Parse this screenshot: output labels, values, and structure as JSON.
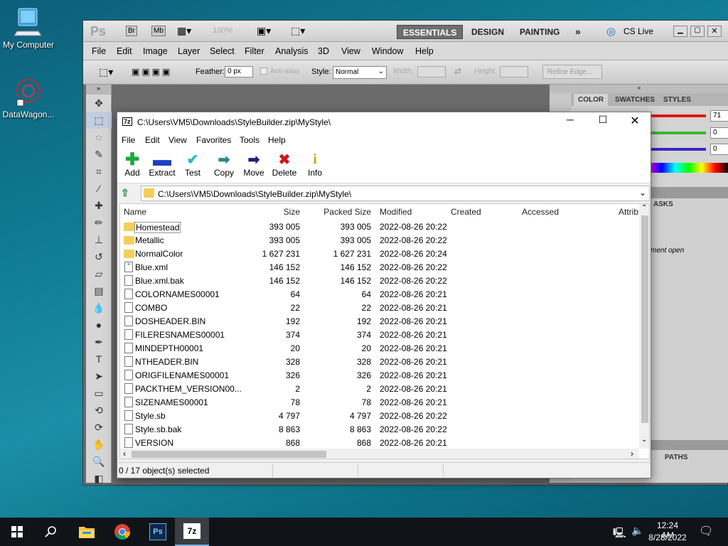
{
  "desktop": {
    "icons": [
      {
        "label": "My Computer",
        "icon": "computer-icon"
      },
      {
        "label": "DataWagon...",
        "icon": "datawagon-icon"
      }
    ]
  },
  "photoshop": {
    "logo": "Ps",
    "app_buttons": [
      "Br",
      "Mb"
    ],
    "zoom": "100%",
    "workspaces": [
      "ESSENTIALS",
      "DESIGN",
      "PAINTING"
    ],
    "more": "»",
    "cslive": "CS Live",
    "menu": [
      "File",
      "Edit",
      "Image",
      "Layer",
      "Select",
      "Filter",
      "Analysis",
      "3D",
      "View",
      "Window",
      "Help"
    ],
    "options": {
      "feather_label": "Feather:",
      "feather_value": "0 px",
      "antialias": "Anti-alias",
      "style_label": "Style:",
      "style_value": "Normal",
      "width_label": "Width:",
      "height_label": "Height:",
      "refine": "Refine Edge..."
    },
    "panel": {
      "tabs": [
        "COLOR",
        "SWATCHES",
        "STYLES"
      ],
      "rgb": [
        "71",
        "0",
        "0"
      ],
      "masks_tab": "ASKS",
      "doc_note": "ment open",
      "paths_tab": "PATHS"
    }
  },
  "zip": {
    "title": "C:\\Users\\VM5\\Downloads\\StyleBuilder.zip\\MyStyle\\",
    "app_icon": "7z",
    "menu": [
      "File",
      "Edit",
      "View",
      "Favorites",
      "Tools",
      "Help"
    ],
    "toolbar": [
      {
        "label": "Add",
        "icon": "plus-icon",
        "color": "#1aa83a"
      },
      {
        "label": "Extract",
        "icon": "minus-icon",
        "color": "#1e3fbf"
      },
      {
        "label": "Test",
        "icon": "check-icon",
        "color": "#28b8c8"
      },
      {
        "label": "Copy",
        "icon": "copy-arrow-icon",
        "color": "#2a8a8a"
      },
      {
        "label": "Move",
        "icon": "move-arrow-icon",
        "color": "#1a237e"
      },
      {
        "label": "Delete",
        "icon": "delete-x-icon",
        "color": "#d01818"
      },
      {
        "label": "Info",
        "icon": "info-icon",
        "color": "#d4b800"
      }
    ],
    "address": "C:\\Users\\VM5\\Downloads\\StyleBuilder.zip\\MyStyle\\",
    "columns": [
      "Name",
      "Size",
      "Packed Size",
      "Modified",
      "Created",
      "Accessed",
      "Attrib"
    ],
    "rows": [
      {
        "name": "Homestead",
        "type": "folder",
        "size": "393 005",
        "packed": "393 005",
        "modified": "2022-08-26 20:22"
      },
      {
        "name": "Metallic",
        "type": "folder",
        "size": "393 005",
        "packed": "393 005",
        "modified": "2022-08-26 20:22"
      },
      {
        "name": "NormalColor",
        "type": "folder",
        "size": "1 627 231",
        "packed": "1 627 231",
        "modified": "2022-08-26 20:24"
      },
      {
        "name": "Blue.xml",
        "type": "xml",
        "size": "146 152",
        "packed": "146 152",
        "modified": "2022-08-26 20:22"
      },
      {
        "name": "Blue.xml.bak",
        "type": "file",
        "size": "146 152",
        "packed": "146 152",
        "modified": "2022-08-26 20:22"
      },
      {
        "name": "COLORNAMES00001",
        "type": "file",
        "size": "64",
        "packed": "64",
        "modified": "2022-08-26 20:21"
      },
      {
        "name": "COMBO",
        "type": "file",
        "size": "22",
        "packed": "22",
        "modified": "2022-08-26 20:21"
      },
      {
        "name": "DOSHEADER.BIN",
        "type": "file",
        "size": "192",
        "packed": "192",
        "modified": "2022-08-26 20:21"
      },
      {
        "name": "FILERESNAMES00001",
        "type": "file",
        "size": "374",
        "packed": "374",
        "modified": "2022-08-26 20:21"
      },
      {
        "name": "MINDEPTH00001",
        "type": "file",
        "size": "20",
        "packed": "20",
        "modified": "2022-08-26 20:21"
      },
      {
        "name": "NTHEADER.BIN",
        "type": "file",
        "size": "328",
        "packed": "328",
        "modified": "2022-08-26 20:21"
      },
      {
        "name": "ORIGFILENAMES00001",
        "type": "file",
        "size": "326",
        "packed": "326",
        "modified": "2022-08-26 20:21"
      },
      {
        "name": "PACKTHEM_VERSION00...",
        "type": "file",
        "size": "2",
        "packed": "2",
        "modified": "2022-08-26 20:21"
      },
      {
        "name": "SIZENAMES00001",
        "type": "file",
        "size": "78",
        "packed": "78",
        "modified": "2022-08-26 20:21"
      },
      {
        "name": "Style.sb",
        "type": "file",
        "size": "4 797",
        "packed": "4 797",
        "modified": "2022-08-26 20:22"
      },
      {
        "name": "Style.sb.bak",
        "type": "file",
        "size": "8 863",
        "packed": "8 863",
        "modified": "2022-08-26 20:22"
      },
      {
        "name": "VERSION",
        "type": "file",
        "size": "868",
        "packed": "868",
        "modified": "2022-08-26 20:21"
      }
    ],
    "status": "0 / 17 object(s) selected"
  },
  "taskbar": {
    "time": "12:24 AM",
    "date": "8/28/2022"
  }
}
